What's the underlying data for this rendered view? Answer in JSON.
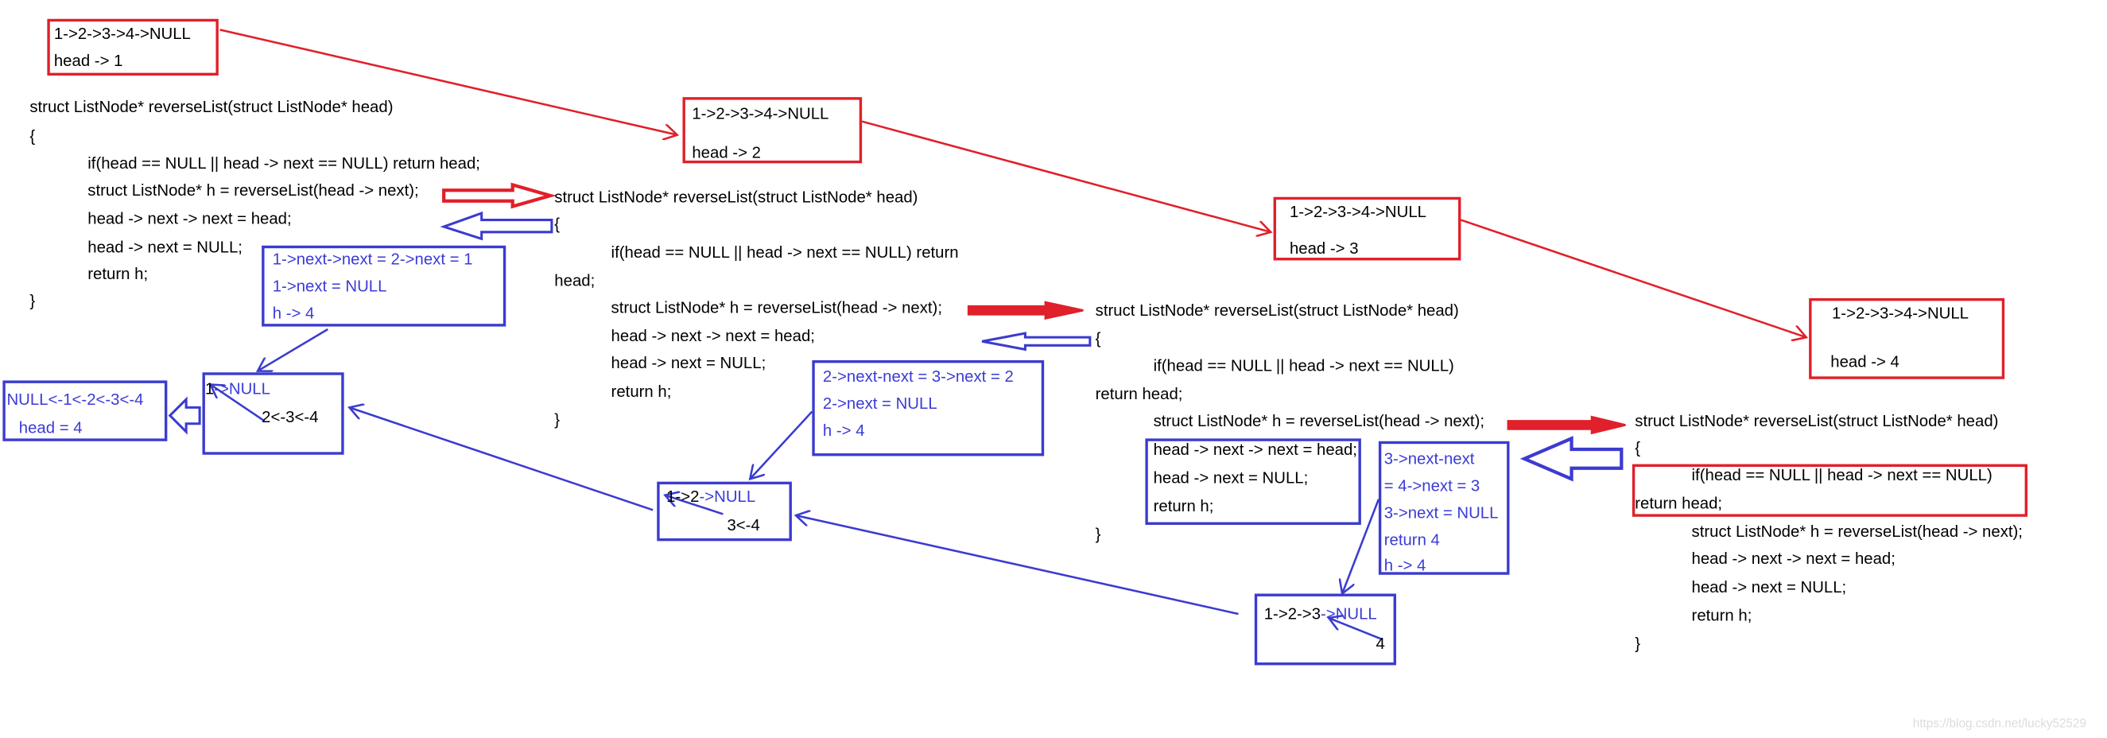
{
  "frames": [
    {
      "list": "1->2->3->4->NULL",
      "head": "head -> 1"
    },
    {
      "list": "1->2->3->4->NULL",
      "head": "head -> 2"
    },
    {
      "list": "1->2->3->4->NULL",
      "head": "head -> 3"
    },
    {
      "list": "1->2->3->4->NULL",
      "head": "head -> 4"
    }
  ],
  "code": {
    "header": "struct ListNode* reverseList(struct ListNode* head)",
    "open": "{",
    "if_full": "if(head == NULL || head -> next == NULL) return head;",
    "if_part1": "if(head == NULL || head -> next == NULL) return",
    "if_part2": "head;",
    "if_cond": "if(head == NULL || head -> next == NULL)",
    "return_head": "return head;",
    "recurse": "struct ListNode* h = reverseList(head -> next);",
    "link": "head -> next -> next = head;",
    "nullify": "head -> next = NULL;",
    "return_h": "return h;",
    "close": "}"
  },
  "notes": [
    [
      "1->next->next = 2->next = 1",
      "1->next = NULL",
      "h -> 4"
    ],
    [
      "2->next-next = 3->next = 2",
      "2->next = NULL",
      "h -> 4"
    ],
    [
      "3->next-next",
      "= 4->next = 3",
      "3->next = NULL",
      "return 4",
      "h -> 4"
    ]
  ],
  "results": {
    "final": {
      "line1": "NULL<-1<-2<-3<-4",
      "line2": "head = 4"
    },
    "r1": {
      "a": "1",
      "b": "->NULL",
      "c": "2<-3<-4"
    },
    "r2": {
      "a": "1->2",
      "b": "->NULL",
      "c": "3<-4"
    },
    "r3": {
      "a": "1->2->3",
      "b": "->NULL",
      "c": "4"
    }
  },
  "watermark": "https://blog.csdn.net/lucky52529",
  "colors": {
    "call": "#e0202a",
    "return": "#3b3bd0"
  }
}
